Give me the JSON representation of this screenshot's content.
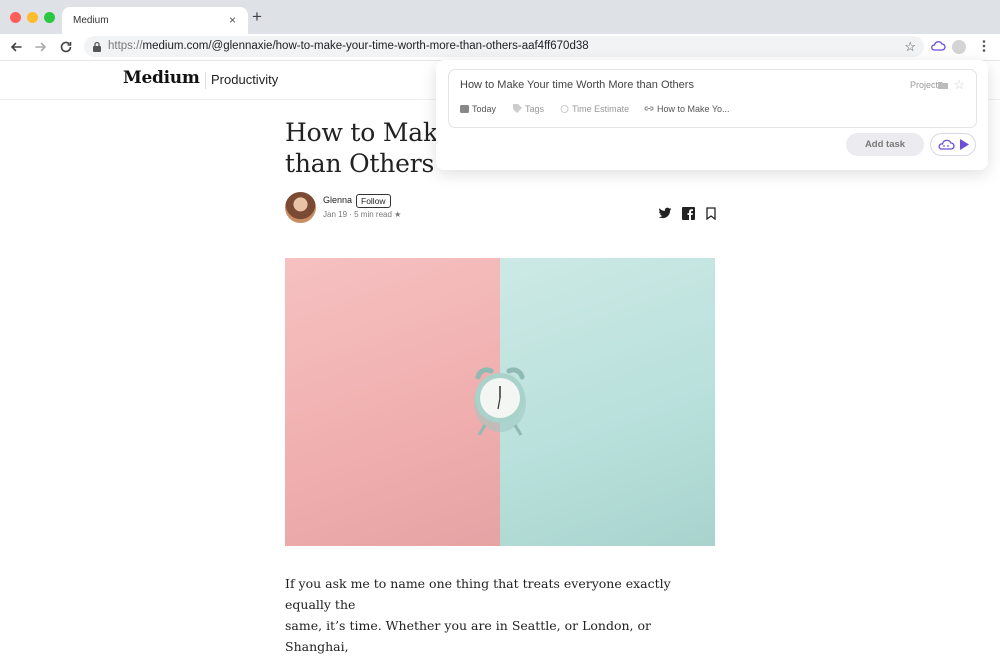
{
  "browser": {
    "tab_title": "Medium",
    "tab_close": "×",
    "new_tab": "+",
    "url_protocol": "https://",
    "url_rest": "medium.com/@glennaxie/how-to-make-your-time-worth-more-than-others-aaf4ff670d38",
    "bookmark_star": "☆"
  },
  "medium": {
    "logo": "Medium",
    "section": "Productivity"
  },
  "article": {
    "title_line1": "How to Make",
    "title_line2": "than Others",
    "author": "Glenna",
    "follow_label": "Follow",
    "meta": "Jan 19 · 5 min read ★",
    "body_line1": "If you ask me to name one thing that treats everyone exactly equally the",
    "body_line2": "same, it’s time. Whether you are in Seattle, or London, or Shanghai,"
  },
  "popup": {
    "task_title": "How to Make Your time Worth More than Others",
    "project_label": "Project",
    "chips": {
      "today": "Today",
      "tags": "Tags",
      "time_estimate": "Time Estimate",
      "link": "How to Make Yo..."
    },
    "add_task_label": "Add task",
    "fav_star": "☆"
  },
  "colors": {
    "accent_purple": "#6b4fd8",
    "hero_pink": "#f3b5b5",
    "hero_mint": "#bfe3de"
  }
}
